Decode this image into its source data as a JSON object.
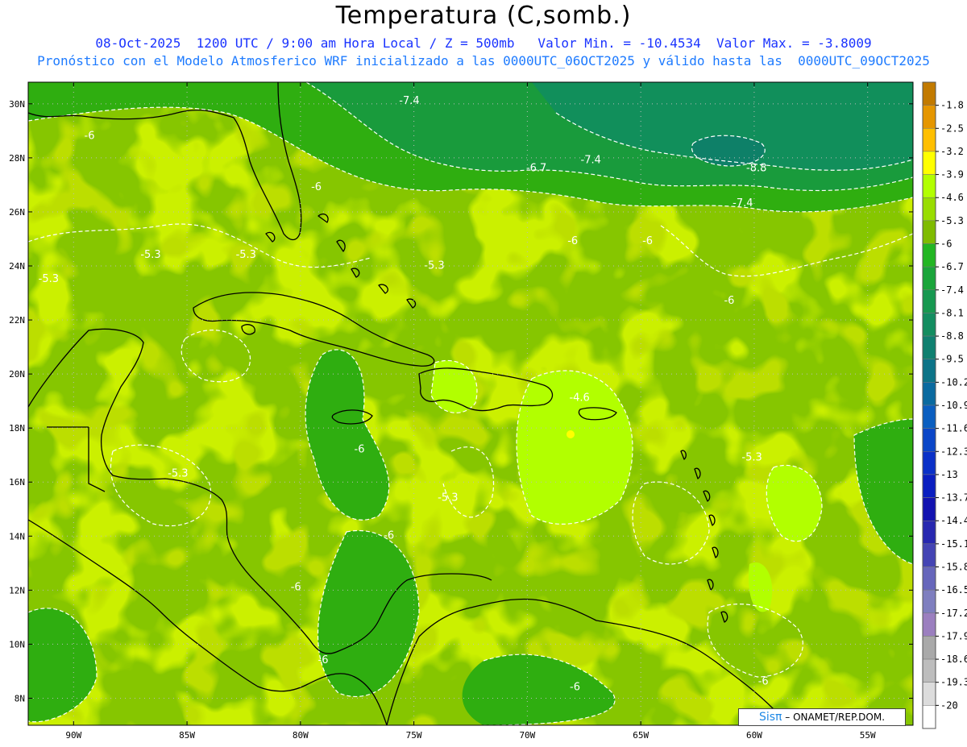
{
  "header": {
    "title": "Temperatura (C,somb.)",
    "line1": "08-Oct-2025  1200 UTC / 9:00 am Hora Local / Z = 500mb   Valor Min. = -10.4534  Valor Max. = -3.8009",
    "line2": "Pronóstico con el Modelo Atmosferico WRF inicializado a las 0000UTC_06OCT2025 y válido hasta las  0000UTC_09OCT2025"
  },
  "map": {
    "lon_range": [
      -92,
      -53
    ],
    "lat_range": [
      7,
      30.8
    ],
    "lat_ticks": [
      "30N",
      "28N",
      "26N",
      "24N",
      "22N",
      "20N",
      "18N",
      "16N",
      "14N",
      "12N",
      "10N",
      "8N"
    ],
    "lat_values": [
      30,
      28,
      26,
      24,
      22,
      20,
      18,
      16,
      14,
      12,
      10,
      8
    ],
    "lon_ticks": [
      "90W",
      "85W",
      "80W",
      "75W",
      "70W",
      "65W",
      "60W",
      "55W"
    ],
    "lon_values": [
      -90,
      -85,
      -80,
      -75,
      -70,
      -65,
      -60,
      -55
    ],
    "contour_labels": [
      {
        "text": "-7.4",
        "lon": -75.2,
        "lat": 30.0
      },
      {
        "text": "-6",
        "lon": -89.3,
        "lat": 28.7
      },
      {
        "text": "-6.7",
        "lon": -69.6,
        "lat": 27.5
      },
      {
        "text": "-7.4",
        "lon": -67.2,
        "lat": 27.8
      },
      {
        "text": "-8.8",
        "lon": -59.9,
        "lat": 27.5
      },
      {
        "text": "-7.4",
        "lon": -60.5,
        "lat": 26.2
      },
      {
        "text": "-6",
        "lon": -79.3,
        "lat": 26.8
      },
      {
        "text": "-6",
        "lon": -68.0,
        "lat": 24.8
      },
      {
        "text": "-6",
        "lon": -64.7,
        "lat": 24.8
      },
      {
        "text": "-6",
        "lon": -61.1,
        "lat": 22.6
      },
      {
        "text": "-5.3",
        "lon": -86.6,
        "lat": 24.3
      },
      {
        "text": "-5.3",
        "lon": -82.4,
        "lat": 24.3
      },
      {
        "text": "-5.3",
        "lon": -74.1,
        "lat": 23.9
      },
      {
        "text": "-5.3",
        "lon": -91.1,
        "lat": 23.4
      },
      {
        "text": "-4.6",
        "lon": -67.7,
        "lat": 19.0
      },
      {
        "text": "-6",
        "lon": -77.4,
        "lat": 17.1
      },
      {
        "text": "-5.3",
        "lon": -85.4,
        "lat": 16.2
      },
      {
        "text": "-5.3",
        "lon": -60.1,
        "lat": 16.8
      },
      {
        "text": "-5.3",
        "lon": -73.5,
        "lat": 15.3
      },
      {
        "text": "-6",
        "lon": -76.1,
        "lat": 13.9
      },
      {
        "text": "-6",
        "lon": -80.2,
        "lat": 12.0
      },
      {
        "text": "-6",
        "lon": -79.0,
        "lat": 9.3
      },
      {
        "text": "-6",
        "lon": -67.9,
        "lat": 8.3
      },
      {
        "text": "-6",
        "lon": -59.6,
        "lat": 8.5
      }
    ]
  },
  "colorbar": {
    "labels": [
      "-1.8",
      "-2.5",
      "-3.2",
      "-3.9",
      "-4.6",
      "-5.3",
      "-6",
      "-6.7",
      "-7.4",
      "-8.1",
      "-8.8",
      "-9.5",
      "-10.2",
      "-10.9",
      "-11.6",
      "-12.3",
      "-13",
      "-13.7",
      "-14.4",
      "-15.1",
      "-15.8",
      "-16.5",
      "-17.2",
      "-17.9",
      "-18.6",
      "-19.3",
      "-20"
    ],
    "colors": [
      "#c27a00",
      "#e59600",
      "#ffbf00",
      "#ffff00",
      "#b2ff00",
      "#99dd00",
      "#7fbb00",
      "#22b622",
      "#1aa53a",
      "#179850",
      "#138d60",
      "#0f8070",
      "#0c7488",
      "#0a6aa0",
      "#0a5ec0",
      "#0a46c8",
      "#0a30c8",
      "#0a1ec0",
      "#1212b0",
      "#2828b0",
      "#4444b4",
      "#6666bb",
      "#7f7fbf",
      "#9b7fbf",
      "#a9a9a9",
      "#bdbdbd",
      "#dcdcdc",
      "#ffffff"
    ]
  },
  "credit": {
    "brand": "Sisπ",
    "text": "– ONAMET/REP.DOM."
  }
}
